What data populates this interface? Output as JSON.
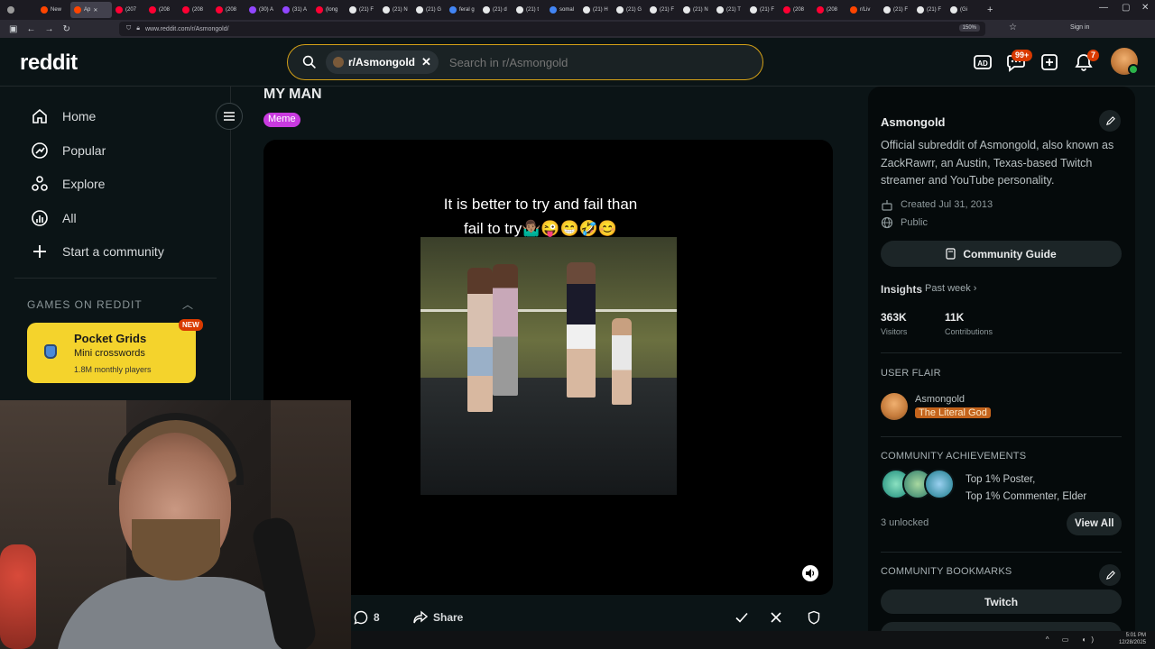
{
  "browser": {
    "tabs": [
      {
        "label": "",
        "color": "#9a9a9a"
      },
      {
        "label": "New",
        "color": "#ff4500"
      },
      {
        "label": "Ap",
        "color": "#ff4500",
        "active": true
      },
      {
        "label": "(207",
        "color": "#ff0033"
      },
      {
        "label": "(208",
        "color": "#ff0033"
      },
      {
        "label": "(208",
        "color": "#ff0033"
      },
      {
        "label": "(208",
        "color": "#ff0033"
      },
      {
        "label": "(30) A",
        "color": "#9146ff"
      },
      {
        "label": "(31) A",
        "color": "#9146ff"
      },
      {
        "label": "(long",
        "color": "#ff0033"
      },
      {
        "label": "(21) F",
        "color": "#e7e9ea"
      },
      {
        "label": "(21) N",
        "color": "#e7e9ea"
      },
      {
        "label": "(21) G",
        "color": "#e7e9ea"
      },
      {
        "label": "feral g",
        "color": "#4285f4"
      },
      {
        "label": "(21) d",
        "color": "#e7e9ea"
      },
      {
        "label": "(21) t",
        "color": "#e7e9ea"
      },
      {
        "label": "somal",
        "color": "#4285f4"
      },
      {
        "label": "(21) H",
        "color": "#e7e9ea"
      },
      {
        "label": "(21) G",
        "color": "#e7e9ea"
      },
      {
        "label": "(21) F",
        "color": "#e7e9ea"
      },
      {
        "label": "(21) N",
        "color": "#e7e9ea"
      },
      {
        "label": "(21) T",
        "color": "#e7e9ea"
      },
      {
        "label": "(21) F",
        "color": "#e7e9ea"
      },
      {
        "label": "(208",
        "color": "#ff0033"
      },
      {
        "label": "(208",
        "color": "#ff0033"
      },
      {
        "label": "r/Liv",
        "color": "#ff4500"
      },
      {
        "label": "(21) F",
        "color": "#e7e9ea"
      },
      {
        "label": "(21) F",
        "color": "#e7e9ea"
      },
      {
        "label": "(Gi",
        "color": "#e7e9ea"
      }
    ],
    "url": "www.reddit.com/r/Asmongold/",
    "zoom": "150%",
    "sign_in": "Sign in"
  },
  "header": {
    "logo": "reddit",
    "search_chip": "r/Asmongold",
    "search_placeholder": "Search in r/Asmongold",
    "chat_badge": "99+",
    "notif_badge": "7"
  },
  "leftnav": {
    "items": [
      "Home",
      "Popular",
      "Explore",
      "All",
      "Start a community"
    ],
    "games_header": "GAMES ON REDDIT",
    "game": {
      "title": "Pocket Grids",
      "subtitle": "Mini crosswords",
      "players": "1.8M monthly players",
      "badge": "NEW"
    }
  },
  "post": {
    "title": "MY MAN",
    "flair": "Meme",
    "caption_line1": "It is better to try and fail than",
    "caption_line2": "fail to try🤷🏽‍♂️😜😁🤣😊",
    "comments": "8",
    "share": "Share"
  },
  "sidebar": {
    "name": "Asmongold",
    "description": "Official subreddit of Asmongold, also known as ZackRawrr, an Austin, Texas-based Twitch streamer and YouTube personality.",
    "created": "Created Jul 31, 2013",
    "visibility": "Public",
    "guide": "Community Guide",
    "insights": "Insights",
    "past_week": "Past week ›",
    "visitors_value": "363K",
    "visitors_label": "Visitors",
    "contrib_value": "11K",
    "contrib_label": "Contributions",
    "user_flair_header": "USER FLAIR",
    "flair_user": "Asmongold",
    "flair_tag": "The Literal God",
    "achievements_header": "COMMUNITY ACHIEVEMENTS",
    "achievements_line1": "Top 1% Poster,",
    "achievements_line2": "Top 1% Commenter, Elder",
    "unlocked": "3 unlocked",
    "view_all": "View All",
    "bookmarks_header": "COMMUNITY BOOKMARKS",
    "bookmark_1": "Twitch"
  },
  "taskbar": {
    "time": "5:01 PM",
    "date": "12/28/2025"
  }
}
